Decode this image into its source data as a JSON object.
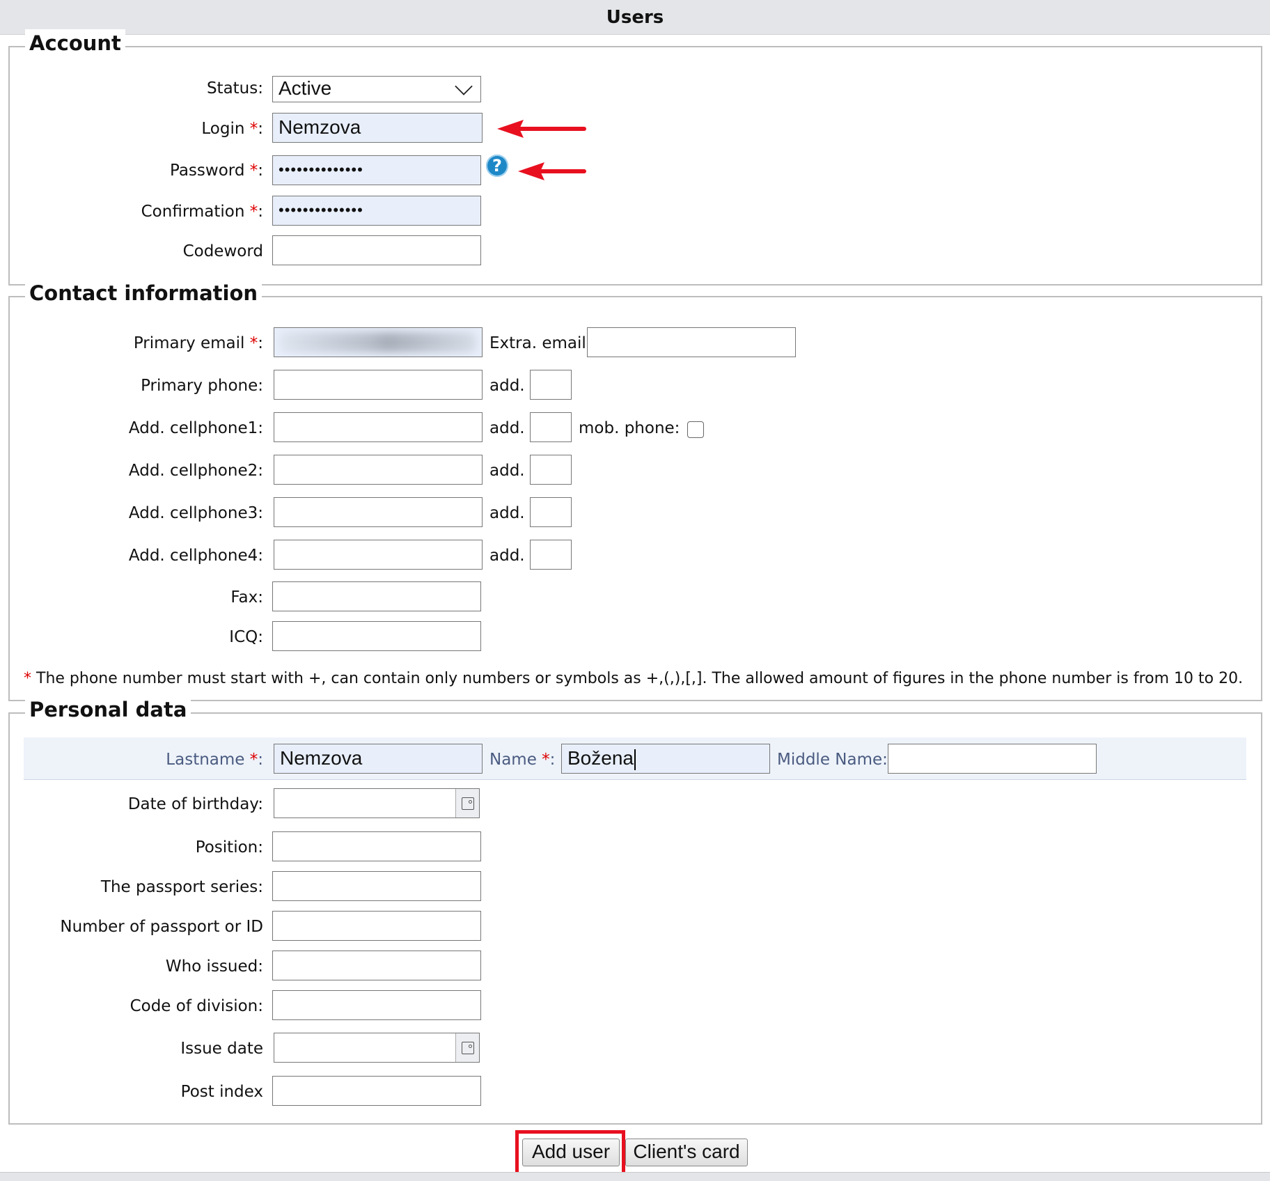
{
  "title": "Users",
  "account": {
    "legend": "Account",
    "status_label": "Status:",
    "status_value": "Active",
    "login_label": "Login",
    "login_value": "Nemzova",
    "password_label": "Password",
    "password_value": "••••••••••••••",
    "confirmation_label": "Confirmation",
    "confirmation_value": "••••••••••••••",
    "codeword_label": "Codeword",
    "help_icon": "?"
  },
  "contact": {
    "legend": "Contact information",
    "primary_email_label": "Primary email",
    "extra_email_label": "Extra. email",
    "primary_phone_label": "Primary phone:",
    "cell1_label": "Add. cellphone1:",
    "cell2_label": "Add. cellphone2:",
    "cell3_label": "Add. cellphone3:",
    "cell4_label": "Add. cellphone4:",
    "add_label": "add.",
    "mob_phone_label": "mob. phone:",
    "fax_label": "Fax:",
    "icq_label": "ICQ:",
    "note": "The phone number must start with +, can contain only numbers or symbols as +,(,),[,]. The allowed amount of figures in the phone number is from 10 to 20."
  },
  "personal": {
    "legend": "Personal data",
    "lastname_label": "Lastname",
    "lastname_value": "Nemzova",
    "name_label": "Name",
    "name_value": "Božena",
    "middle_name_label": "Middle Name:",
    "birthday_label": "Date of birthday:",
    "position_label": "Position:",
    "passport_series_label": "The passport series:",
    "passport_number_label": "Number of passport or ID",
    "who_issued_label": "Who issued:",
    "division_code_label": "Code of division:",
    "issue_date_label": "Issue date",
    "post_index_label": "Post index"
  },
  "req_marker": "*",
  "colon": ":",
  "buttons": {
    "add_user": "Add user",
    "clients_card": "Client's card"
  },
  "colors": {
    "required": "#dd0000",
    "annotation": "#e8101f",
    "help": "#1e88c7"
  }
}
